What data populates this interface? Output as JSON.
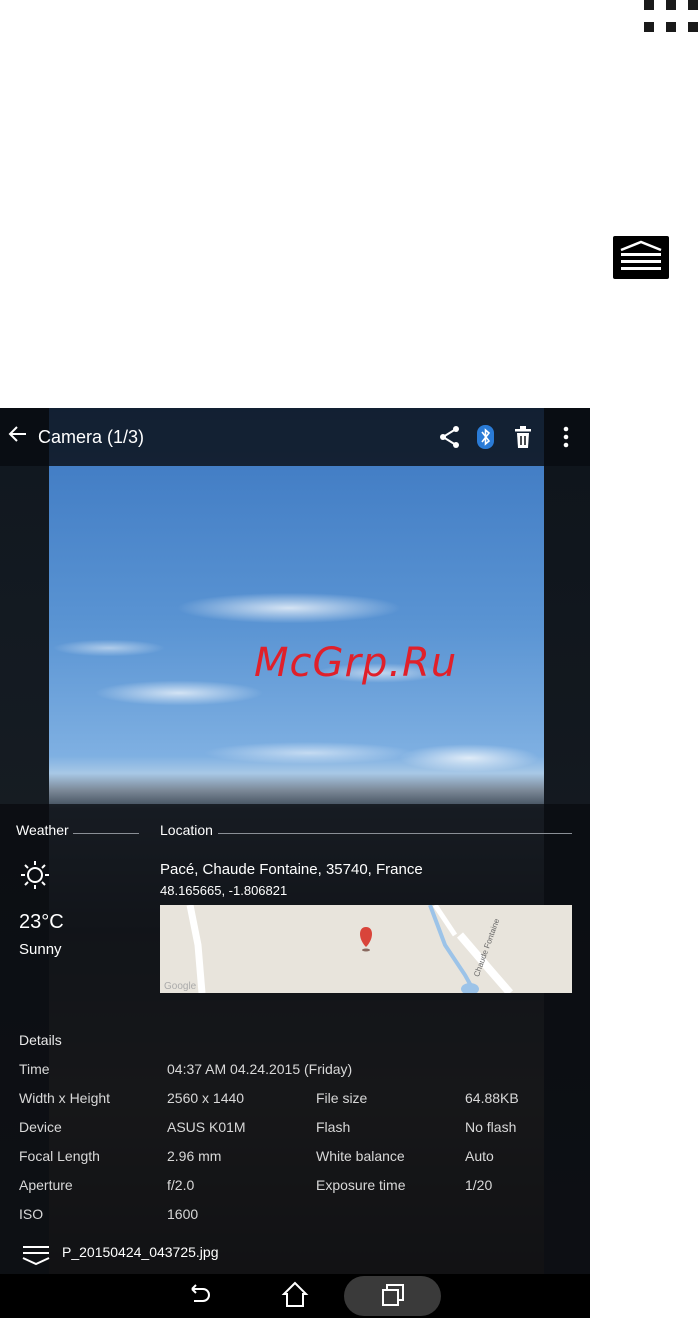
{
  "app_bar": {
    "title": "Camera (1/3)"
  },
  "watermark": "McGrp.Ru",
  "weather": {
    "label": "Weather",
    "temperature": "23°C",
    "condition": "Sunny"
  },
  "location": {
    "label": "Location",
    "address": "Pacé, Chaude Fontaine, 35740, France",
    "coordinates": "48.165665, -1.806821",
    "map_road_label": "Chaude Fontaine",
    "map_brand": "Google"
  },
  "details": {
    "title": "Details",
    "time": {
      "label": "Time",
      "value": "04:37 AM 04.24.2015 (Friday)"
    },
    "rows": [
      {
        "label": "Width x Height",
        "value": "2560 x 1440",
        "label2": "File size",
        "value2": "64.88KB"
      },
      {
        "label": "Device",
        "value": "ASUS K01M",
        "label2": "Flash",
        "value2": "No flash"
      },
      {
        "label": "Focal Length",
        "value": "2.96 mm",
        "label2": "White balance",
        "value2": "Auto"
      },
      {
        "label": "Aperture",
        "value": "f/2.0",
        "label2": "Exposure time",
        "value2": "1/20"
      },
      {
        "label": "ISO",
        "value": "1600",
        "label2": "",
        "value2": ""
      }
    ]
  },
  "file": {
    "name": "P_20150424_043725.jpg"
  },
  "colors": {
    "accent_bluetooth": "#2a7bd6",
    "map_pin": "#d9443a"
  }
}
